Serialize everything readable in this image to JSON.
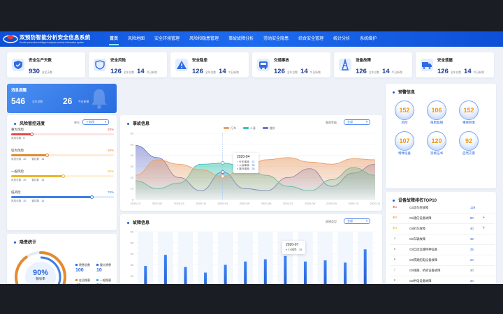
{
  "header": {
    "title": "双预防智能分析安全信息系统",
    "subtitle": "Double prevention intelligent analysis security information system",
    "nav": [
      "首页",
      "风险地图",
      "安全环境管理",
      "风险和隐患管理",
      "事故故障分析",
      "劳动安全隐患",
      "综合安全管理",
      "统计分析",
      "系统维护"
    ],
    "active_nav": 0
  },
  "stats": [
    {
      "name": "安全生产天数",
      "value": "930",
      "unit": "安全天数",
      "icon": "shield-check-icon"
    },
    {
      "name": "安全风险",
      "value": "126",
      "unit": "全年总数",
      "today": "14",
      "today_label": "今日新增",
      "icon": "shield-icon"
    },
    {
      "name": "安全隐患",
      "value": "126",
      "unit": "全年总数",
      "today": "14",
      "today_label": "今日新增",
      "icon": "warning-icon"
    },
    {
      "name": "交通事故",
      "value": "126",
      "unit": "全年总数",
      "today": "14",
      "today_label": "今日新增",
      "icon": "bus-icon"
    },
    {
      "name": "设备故障",
      "value": "126",
      "unit": "全年总数",
      "today": "14",
      "today_label": "今日新增",
      "icon": "tower-icon"
    },
    {
      "name": "安全遗屋",
      "value": "126",
      "unit": "全年总数",
      "today": "14",
      "today_label": "今日新增",
      "icon": "truck-icon"
    }
  ],
  "message": {
    "title": "消息提醒",
    "total": "546",
    "total_label": "全年总数",
    "today": "26",
    "today_label": "今日新增"
  },
  "risk": {
    "title": "风险管控进度",
    "select_label": "单位",
    "select_value": "工务段",
    "items": [
      {
        "name": "重大风险",
        "pct": "20%",
        "fraction": 0.2,
        "color": "#e24b4b",
        "track": "#fbe5e5",
        "total_label": "风险总数",
        "total": "8",
        "done_label": "",
        "done": ""
      },
      {
        "name": "较大风险",
        "pct": "35%",
        "fraction": 0.35,
        "color": "#e58a2f",
        "track": "#fcecde",
        "total_label": "风险总数",
        "total": "20",
        "done_label": "管控数",
        "done": "14"
      },
      {
        "name": "一般风险",
        "pct": "50%",
        "fraction": 0.5,
        "color": "#e8b52b",
        "track": "#fdf3d8",
        "total_label": "风险总数",
        "total": "20",
        "done_label": "管控数",
        "done": "14"
      },
      {
        "name": "低风险",
        "pct": "78%",
        "fraction": 0.78,
        "color": "#3c7ee8",
        "track": "#e2ecfd",
        "total_label": "风险总数",
        "total": "20",
        "done_label": "管控数",
        "done": "14"
      }
    ]
  },
  "hazard": {
    "title": "隐患统计",
    "ring_value": "90%",
    "ring_label": "销号率",
    "ring_fraction": 0.9,
    "legend": [
      {
        "label": "隐患总数",
        "value": "100",
        "color": "#2f6be0"
      },
      {
        "label": "重大隐患",
        "value": "10",
        "color": "#2f6be0"
      },
      {
        "label": "在治隐患",
        "value": "40",
        "color": "#e58a2f"
      },
      {
        "label": "一般隐患",
        "value": "50",
        "color": "#3fb0f0"
      }
    ]
  },
  "accident_chart": {
    "title": "事故信息",
    "select_label": "事故等级",
    "select_value": "全部",
    "tooltip": {
      "title": "2020-04",
      "rows": [
        {
          "label": "行车事故:",
          "value": "21"
        },
        {
          "label": "人身事故:",
          "value": "33"
        },
        {
          "label": "路外事故:",
          "value": "25"
        }
      ]
    }
  },
  "chart_data": [
    {
      "type": "area",
      "x": [
        "2019-12",
        "2020-01",
        "2020-02",
        "2020-03",
        "2020-04",
        "2020-05",
        "2020-06",
        "2020-07",
        "2020-08",
        "2020-09",
        "2020-10",
        "2020-11"
      ],
      "ylim": [
        0,
        60
      ],
      "yticks": [
        0,
        10,
        20,
        30,
        40,
        50,
        60
      ],
      "series": [
        {
          "name": "行车",
          "color": "#e8a06a",
          "values": [
            22,
            36,
            32,
            27,
            21,
            28,
            36,
            38,
            34,
            32,
            37,
            36
          ]
        },
        {
          "name": "人身",
          "color": "#3fc4b0",
          "values": [
            17,
            10,
            15,
            32,
            33,
            30,
            22,
            12,
            8,
            18,
            29,
            22
          ]
        },
        {
          "name": "路外",
          "color": "#6b76c8",
          "values": [
            49,
            38,
            20,
            8,
            25,
            10,
            8,
            20,
            28,
            12,
            24,
            32
          ]
        }
      ]
    },
    {
      "type": "bar",
      "title": "故障信息",
      "categories": [
        "2019-12",
        "2020-01",
        "2020-02",
        "2020-03",
        "2020-04",
        "2020-05",
        "2020-06",
        "2020-07",
        "2020-08",
        "2020-09",
        "2020-10",
        "2020-11"
      ],
      "ylim": [
        0,
        60
      ],
      "yticks": [
        0,
        10,
        20,
        30,
        40,
        50,
        60
      ],
      "series": [
        {
          "name": "XX故障",
          "values": [
            29,
            39,
            28,
            23,
            30,
            33,
            35,
            38,
            33,
            34,
            32,
            44
          ]
        }
      ]
    }
  ],
  "fault_chart": {
    "title": "故障信息",
    "select_label": "故障类型",
    "select_value": "全部",
    "tooltip": {
      "title": "2020-07",
      "rows": [
        {
          "label": "XX故障:",
          "value": "38"
        }
      ]
    }
  },
  "warning": {
    "title": "预警信息",
    "items": [
      {
        "value": "152",
        "label": "风险"
      },
      {
        "value": "106",
        "label": "隐患超期"
      },
      {
        "value": "152",
        "label": "事故频发"
      },
      {
        "value": "107",
        "label": "特种设备"
      },
      {
        "value": "120",
        "label": "资格证书"
      },
      {
        "value": "92",
        "label": "自然灾害"
      }
    ]
  },
  "top10": {
    "title": "设备故障排名TOP10",
    "rows": [
      {
        "rank": "1",
        "name": "G3动车组故障",
        "count": "129",
        "flag": false
      },
      {
        "rank": "2",
        "name": "G8通信设备故障",
        "count": "80",
        "flag": true
      },
      {
        "rank": "3",
        "name": "G8机车故障",
        "count": "40",
        "flag": true
      },
      {
        "rank": "4",
        "name": "G8车辆故障",
        "count": "39",
        "flag": false
      },
      {
        "rank": "5",
        "name": "G8自动运输特种设备",
        "count": "25",
        "flag": false
      },
      {
        "rank": "6",
        "name": "G8铁路配电设备故障",
        "count": "20",
        "flag": false
      },
      {
        "rank": "7",
        "name": "G8线路、桥梁设备故障",
        "count": "20",
        "flag": false
      },
      {
        "rank": "8",
        "name": "G8供电设备故障",
        "count": "20",
        "flag": false
      },
      {
        "rank": "9",
        "name": "G8监测、监控设备",
        "count": "20",
        "flag": false
      },
      {
        "rank": "10",
        "name": "G8供电设备故障",
        "count": "20",
        "flag": false
      }
    ]
  },
  "colors": {
    "primary": "#1d5fd8",
    "header": "#0d4fd6",
    "background": "#eef2f8"
  }
}
